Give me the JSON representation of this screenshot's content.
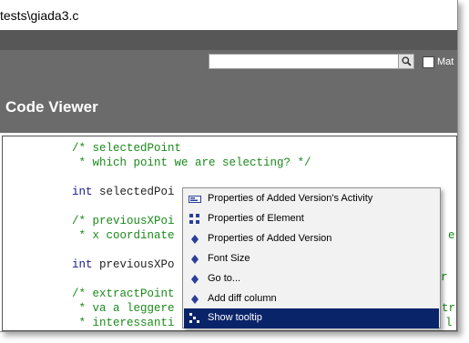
{
  "window": {
    "title": "tests\\giada3.c"
  },
  "toolbar": {
    "search_value": "",
    "match_label": "Mat"
  },
  "panel": {
    "title": "Code Viewer"
  },
  "code": {
    "lines": [
      {
        "kind": "cm",
        "text": "/* selectedPoint"
      },
      {
        "kind": "cm",
        "text": " * which point we are selecting? */"
      },
      {
        "kind": "kw",
        "text": "int",
        "rest": " selectedPoi"
      },
      {
        "kind": "cm",
        "text": "/* previousXPoi"
      },
      {
        "kind": "cm",
        "text": " * x coordinate"
      },
      {
        "kind": "kw",
        "text": "int",
        "rest": " previousXPo"
      },
      {
        "kind": "cm",
        "text": "/* extractPoint"
      },
      {
        "kind": "cm",
        "text": " * va a leggere"
      },
      {
        "kind": "cm",
        "text": " * interessanti"
      }
    ],
    "tails": [
      "e",
      "r",
      "tr",
      "l"
    ]
  },
  "context_menu": {
    "items": [
      {
        "label": "Properties of Added Version's Activity",
        "icon": "activity-properties-icon"
      },
      {
        "label": "Properties of Element",
        "icon": "element-properties-icon"
      },
      {
        "label": "Properties of Added Version",
        "icon": "version-properties-icon"
      },
      {
        "label": "Font Size",
        "icon": "font-size-icon"
      },
      {
        "label": "Go to...",
        "icon": "goto-icon"
      },
      {
        "label": "Add diff column",
        "icon": "diff-column-icon"
      },
      {
        "label": "Show tooltip",
        "icon": "tooltip-icon",
        "selected": true
      }
    ]
  },
  "colors": {
    "header": "#6b6b6b",
    "comment": "#1a8a1a",
    "keyword": "#1a1a8c",
    "menu_selection": "#0a246a"
  }
}
